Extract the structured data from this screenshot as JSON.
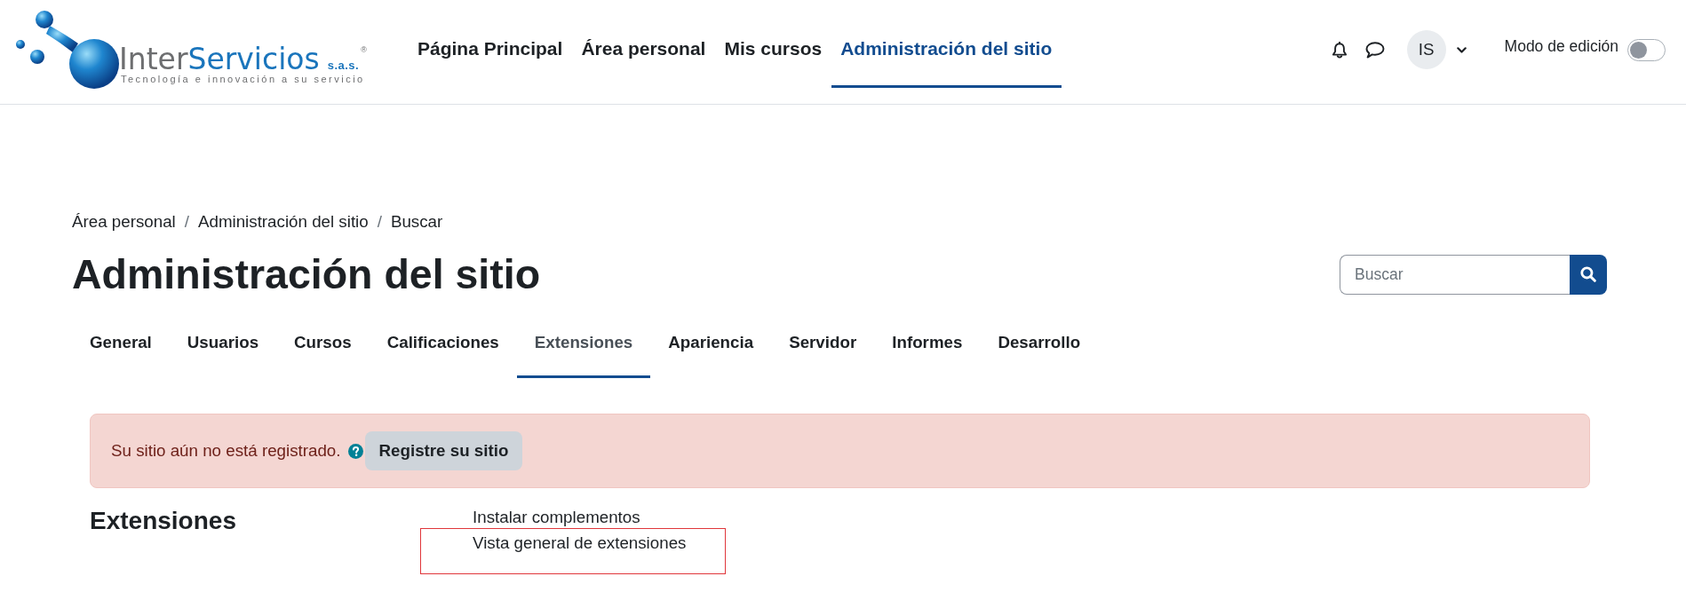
{
  "header": {
    "logo": {
      "wordmark_start": "Inter",
      "wordmark_end": "Servicios",
      "suffix": "s.a.s.",
      "registered": "®",
      "tagline": "Tecnología e innovación a su servicio"
    },
    "nav": [
      {
        "label": "Página Principal",
        "selected": false
      },
      {
        "label": "Área personal",
        "selected": false
      },
      {
        "label": "Mis cursos",
        "selected": false
      },
      {
        "label": "Administración del sitio",
        "selected": true
      }
    ],
    "user": {
      "initials": "IS"
    },
    "edit_mode": {
      "label": "Modo de edición",
      "on": false
    }
  },
  "breadcrumb": [
    {
      "text": "Área personal",
      "kind": "link"
    },
    {
      "text": "/",
      "kind": "separator"
    },
    {
      "text": "Administración del sitio",
      "kind": "link"
    },
    {
      "text": "/",
      "kind": "separator"
    },
    {
      "text": "Buscar",
      "kind": "current"
    }
  ],
  "page_title": "Administración del sitio",
  "search": {
    "placeholder": "Buscar"
  },
  "tabs": [
    {
      "label": "General",
      "selected": false
    },
    {
      "label": "Usuarios",
      "selected": false
    },
    {
      "label": "Cursos",
      "selected": false
    },
    {
      "label": "Calificaciones",
      "selected": false
    },
    {
      "label": "Extensiones",
      "selected": true
    },
    {
      "label": "Apariencia",
      "selected": false
    },
    {
      "label": "Servidor",
      "selected": false
    },
    {
      "label": "Informes",
      "selected": false
    },
    {
      "label": "Desarrollo",
      "selected": false
    }
  ],
  "alert": {
    "message": "Su sitio aún no está registrado.",
    "button": "Registre su sitio"
  },
  "section": {
    "heading": "Extensiones",
    "links": [
      {
        "label": "Instalar complementos",
        "highlighted": false
      },
      {
        "label": "Vista general de extensiones",
        "highlighted": true
      }
    ]
  }
}
